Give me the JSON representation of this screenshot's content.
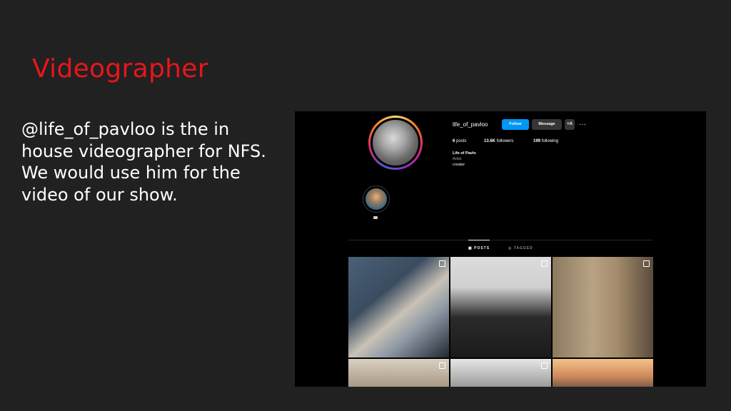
{
  "slide": {
    "title": "Videographer",
    "body": "@life_of_pavloo is the in house videographer for NFS. We would use him for the video of our show."
  },
  "profile": {
    "username": "life_of_pavloo",
    "follow_label": "Follow",
    "message_label": "Message",
    "add_user_label": "+A",
    "more_label": "···",
    "posts_count": "6",
    "posts_label": "posts",
    "followers_count": "13.6K",
    "followers_label": "followers",
    "following_count": "199",
    "following_label": "following",
    "bio_name": "Life of Pavlo",
    "bio_category": "Artist",
    "bio_text": "creator",
    "tabs": [
      {
        "label": "▦ POSTS",
        "active": true
      },
      {
        "label": "◎ TAGGED",
        "active": false
      }
    ],
    "colors": {
      "accent": "#0095f6",
      "title_red": "#e8161b",
      "background": "#000000"
    }
  }
}
